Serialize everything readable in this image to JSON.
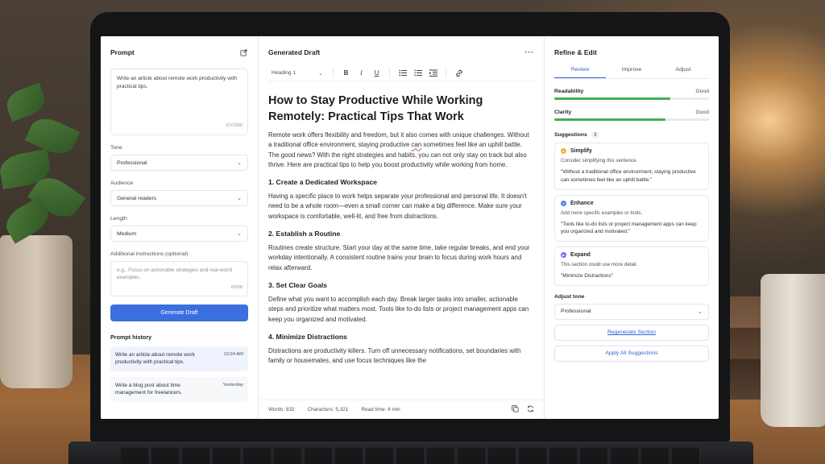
{
  "colors": {
    "accent": "#3b6fe0",
    "good": "#3fae5c",
    "simplify_dot": "#f2b33a",
    "enhance_dot": "#4c86e8",
    "expand_dot": "#8b5cf6"
  },
  "prompt_panel": {
    "title": "Prompt",
    "prompt_text": "Write an article about remote work productivity with practical tips.",
    "prompt_counter": "67/1000",
    "tone_label": "Tone",
    "tone_value": "Professional",
    "audience_label": "Audience",
    "audience_value": "General readers",
    "length_label": "Length",
    "length_value": "Medium",
    "additional_label": "Additional instructions (optional)",
    "additional_placeholder": "e.g., Focus on actionable strategies and real-world examples.",
    "additional_counter": "0/500",
    "generate_label": "Generate Draft",
    "history_title": "Prompt history",
    "history": [
      {
        "text": "Write an article about remote work productivity with practical tips.",
        "time": "10:24 AM"
      },
      {
        "text": "Write a blog post about time management for freelancers.",
        "time": "Yesterday"
      }
    ]
  },
  "draft_panel": {
    "title": "Generated Draft",
    "more_icon": "ellipsis-icon",
    "toolbar": {
      "heading_value": "Heading 1",
      "bold": "B",
      "italic": "I",
      "underline": "U"
    },
    "doc_title": "How to Stay Productive While Working Remotely: Practical Tips That Work",
    "intro_before": "Remote work offers flexibility and freedom, but it also comes with unique challenges. Without a traditional office environment, staying productive ",
    "intro_flagged": "can",
    "intro_after": " sometimes feel like an uphill battle. The good news? With the right strategies and habits, you can not only stay on track but also thrive. Here are practical tips to help you boost productivity while working from home.",
    "sections": [
      {
        "heading": "1. Create a Dedicated Workspace",
        "body": "Having a specific place to work helps separate your professional and personal life. It doesn't need to be a whole room—even a small corner can make a big difference. Make sure your workspace is comfortable, well-lit, and free from distractions."
      },
      {
        "heading": "2. Establish a Routine",
        "body": "Routines create structure. Start your day at the same time, take regular breaks, and end your workday intentionally. A consistent routine trains your brain to focus during work hours and relax afterward."
      },
      {
        "heading": "3. Set Clear Goals",
        "body": "Define what you want to accomplish each day. Break larger tasks into smaller, actionable steps and prioritize what matters most. Tools like to-do lists or project management apps can keep you organized and motivated."
      },
      {
        "heading": "4. Minimize Distractions",
        "body": "Distractions are productivity killers. Turn off unnecessary notifications, set boundaries with family or housemates, and use focus techniques like the"
      }
    ],
    "footer": {
      "words": "Words: 832",
      "characters": "Characters: 5,321",
      "read_time": "Read time: 4 min"
    }
  },
  "refine_panel": {
    "title": "Refine & Edit",
    "tabs": [
      "Review",
      "Improve",
      "Adjust"
    ],
    "active_tab": "Review",
    "metrics": [
      {
        "label": "Readability",
        "value": "Good",
        "level": 0.75
      },
      {
        "label": "Clarity",
        "value": "Good",
        "level": 0.72
      }
    ],
    "suggestions_title": "Suggestions",
    "suggestions_count": "3",
    "suggestions": [
      {
        "type": "Simplify",
        "desc": "Consider simplifying this sentence.",
        "quote": "\"Without a traditional office environment, staying productive can sometimes feel like an uphill battle.\""
      },
      {
        "type": "Enhance",
        "desc": "Add more specific examples or tools.",
        "quote": "\"Tools like to-do lists or project management apps can keep you organized and motivated.\""
      },
      {
        "type": "Expand",
        "desc": "This section could use more detail.",
        "quote": "\"Minimize Distractions\""
      }
    ],
    "adjust_tone_label": "Adjust tone",
    "adjust_tone_value": "Professional",
    "regenerate_label": "Regenerate Section",
    "apply_label": "Apply All Suggestions"
  }
}
